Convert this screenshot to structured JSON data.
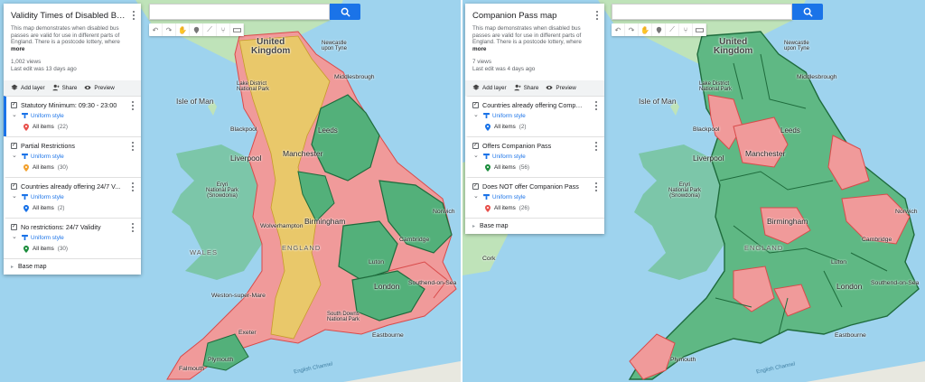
{
  "left": {
    "title": "Validity Times of Disabled Bus Pa...",
    "description": "This map demonstrates when disabled bus passes are valid for use in different parts of England. There is a postcode lottery, where",
    "more": "more",
    "views": "1,002 views",
    "last_edit": "Last edit was 13 days ago",
    "actions": {
      "add_layer": "Add layer",
      "share": "Share",
      "preview": "Preview"
    },
    "layers": [
      {
        "name": "Statutory Minimum: 09:30 - 23:00",
        "style": "Uniform style",
        "items": "All items",
        "count": "(22)",
        "pin_color": "#e8524d"
      },
      {
        "name": "Partial Restrictions",
        "style": "Uniform style",
        "items": "All items",
        "count": "(30)",
        "pin_color": "#f2a12e"
      },
      {
        "name": "Countries already offering 24/7 V...",
        "style": "Uniform style",
        "items": "All items",
        "count": "(2)",
        "pin_color": "#1a73e8"
      },
      {
        "name": "No restrictions: 24/7 Validity",
        "style": "Uniform style",
        "items": "All items",
        "count": "(30)",
        "pin_color": "#1e8e3e"
      }
    ],
    "base_map": "Base map",
    "map_labels": {
      "united_kingdom": "United\nKingdom",
      "isle_of_man": "Isle of Man",
      "newcastle": "Newcastle\nupon Tyne",
      "middlesbrough": "Middlesbrough",
      "lake_district": "Lake District\nNational Park",
      "blackpool": "Blackpool",
      "leeds": "Leeds",
      "liverpool": "Liverpool",
      "manchester": "Manchester",
      "snowdonia": "Eryri\nNational Park\n(Snowdonia)",
      "birmingham": "Birmingham",
      "norwich": "Norwich",
      "wolverhampton": "Wolverhampton",
      "cambridge": "Cambridge",
      "wales": "WALES",
      "england": "ENGLAND",
      "luton": "Luton",
      "london": "London",
      "southend": "Southend-on-Sea",
      "weston": "Weston-super-Mare",
      "south_downs": "South Downs\nNational Park",
      "exeter": "Exeter",
      "eastbourne": "Eastbourne",
      "plymouth": "Plymouth",
      "falmouth": "Falmouth",
      "english_channel": "English Channel"
    }
  },
  "right": {
    "title": "Companion Pass map",
    "description": "This map demonstrates when disabled bus passes are valid for use in different parts of England. There is a postcode lottery, where",
    "more": "more",
    "views": "7 views",
    "last_edit": "Last edit was 4 days ago",
    "actions": {
      "add_layer": "Add layer",
      "share": "Share",
      "preview": "Preview"
    },
    "layers": [
      {
        "name": "Countries already offering Compa...",
        "style": "Uniform style",
        "items": "All items",
        "count": "(2)",
        "pin_color": "#1a73e8"
      },
      {
        "name": "Offers Companion Pass",
        "style": "Uniform style",
        "items": "All items",
        "count": "(56)",
        "pin_color": "#1e8e3e"
      },
      {
        "name": "Does NOT offer Companion Pass",
        "style": "Uniform style",
        "items": "All items",
        "count": "(26)",
        "pin_color": "#e8524d"
      }
    ],
    "base_map": "Base map",
    "map_labels": {
      "united_kingdom": "United\nKingdom",
      "isle_of_man": "Isle of Man",
      "newcastle": "Newcastle\nupon Tyne",
      "middlesbrough": "Middlesbrough",
      "lake_district": "Lake District\nNational Park",
      "blackpool": "Blackpool",
      "leeds": "Leeds",
      "liverpool": "Liverpool",
      "manchester": "Manchester",
      "snowdonia": "Eryri\nNational Park\n(Snowdonia)",
      "birmingham": "Birmingham",
      "norwich": "Norwich",
      "cambridge": "Cambridge",
      "cork": "Cork",
      "england": "ENGLAND",
      "luton": "Luton",
      "london": "London",
      "southend": "Southend-on-Sea",
      "eastbourne": "Eastbourne",
      "plymouth": "Plymouth",
      "english_channel": "English Channel"
    }
  },
  "colors": {
    "sea": "#9ed3ee",
    "land_green": "#9fd5b0",
    "wales": "#7cc6a9",
    "red_region": "#f09a9a",
    "amber_region": "#e9c86a",
    "green_region": "#53b07a",
    "border_dark_green": "#1e6b3c",
    "border_red": "#d94a4a",
    "accent_blue": "#1a73e8"
  }
}
